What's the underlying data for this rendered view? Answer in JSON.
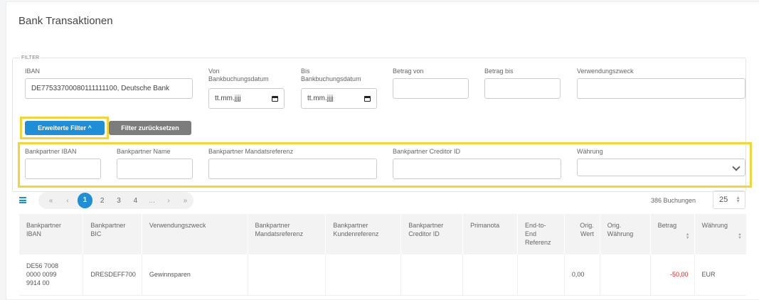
{
  "title": "Bank Transaktionen",
  "filter": {
    "legend": "FILTER",
    "iban_label": "IBAN",
    "iban_value": "DE77533700080111111100, Deutsche Bank",
    "von_label_1": "Von",
    "von_label_2": "Bankbuchungsdatum",
    "von_placeholder": "tt.mm.jjjj",
    "bis_label_1": "Bis",
    "bis_label_2": "Bankbuchungsdatum",
    "bis_placeholder": "tt.mm.jjjj",
    "betrag_von_label": "Betrag von",
    "betrag_bis_label": "Betrag bis",
    "verwendungszweck_label": "Verwendungszweck",
    "advanced_button": "Erweiterte Filter ^",
    "reset_button": "Filter zurücksetzen",
    "partner_iban_label": "Bankpartner IBAN",
    "partner_name_label": "Bankpartner Name",
    "mandate_label": "Bankpartner Mandatsreferenz",
    "creditor_label": "Bankpartner Creditor ID",
    "currency_label": "Währung"
  },
  "pagination": {
    "first": "«",
    "prev": "‹",
    "pages": [
      "1",
      "2",
      "3",
      "4"
    ],
    "ellipsis": "...",
    "next": "›",
    "last": "»",
    "count": "386 Buchungen",
    "page_size": "25"
  },
  "table": {
    "headers": {
      "iban": [
        "Bankpartner",
        "IBAN"
      ],
      "bic": [
        "Bankpartner",
        "BIC"
      ],
      "zweck": [
        "Verwendungszweck"
      ],
      "mandat": [
        "Bankpartner",
        "Mandatsreferenz"
      ],
      "kunde": [
        "Bankpartner",
        "Kundenreferenz"
      ],
      "creditor": [
        "Bankpartner",
        "Creditor ID"
      ],
      "primanota": [
        "Primanota"
      ],
      "e2e": [
        "End-to-",
        "End",
        "Referenz"
      ],
      "origwert": [
        "Orig.",
        "Wert"
      ],
      "origwaehrung": [
        "Orig.",
        "Währung"
      ],
      "betrag": [
        "Betrag"
      ],
      "waehrung": [
        "Währung"
      ]
    },
    "rows": [
      {
        "iban": [
          "DE56 7008",
          "0000 0099",
          "9914 00"
        ],
        "bic": "DRESDEFF700",
        "zweck": "Gewinnsparen",
        "mandat": "",
        "kunde": "",
        "creditor": "",
        "primanota": "",
        "e2e": "",
        "origwert": "0,00",
        "origwaehrung": "",
        "betrag": "-50,00",
        "waehrung": "EUR"
      }
    ]
  },
  "colors": {
    "accent": "#1e8fd6",
    "highlight": "#f5d43a",
    "negative": "#e0201e"
  }
}
